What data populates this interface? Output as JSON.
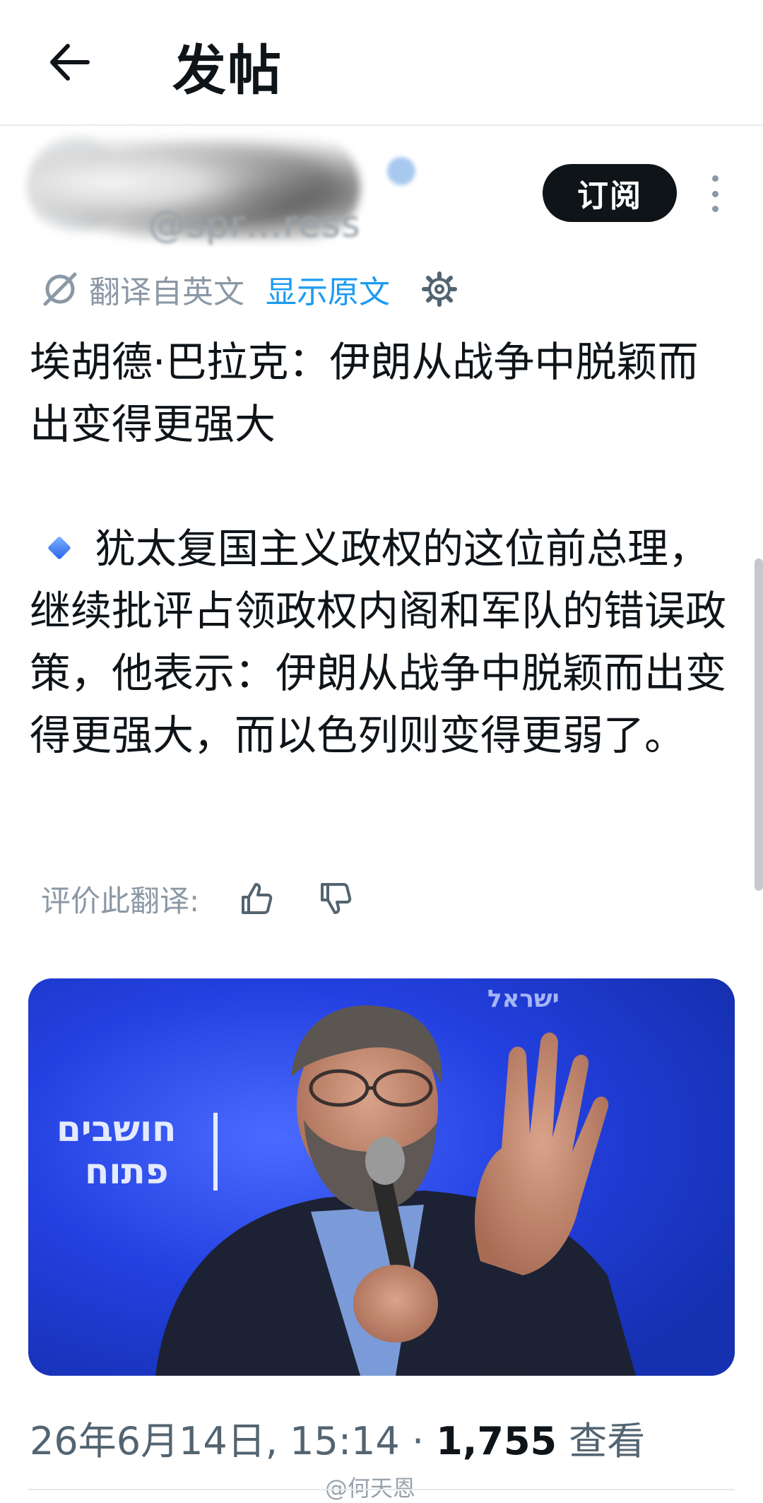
{
  "header": {
    "title": "发帖",
    "back_icon": "arrow-left-icon"
  },
  "author": {
    "handle": "@spr…ress",
    "subscribe_label": "订阅"
  },
  "translation": {
    "translated_from": "翻译自英文",
    "show_original": "显示原文",
    "rate_label": "评价此翻译:"
  },
  "post": {
    "title": "埃胡德·巴拉克：伊朗从战争中脱颖而出变得更强大",
    "body": "犹太复国主义政权的这位前总理，继续批评占领政权内阁和军队的错误政策，他表示：伊朗从战争中脱颖而出变得更强大，而以色列则变得更弱了。"
  },
  "media": {
    "sign_text_1": "חושבים",
    "sign_text_2": "פתוח",
    "sign_text_3": "ישראל"
  },
  "meta": {
    "date": "26年6月14日",
    "time": "15:14",
    "separator": "·",
    "views_count": "1,755",
    "views_label": "查看"
  },
  "watermark": "@何天恩",
  "colors": {
    "accent": "#1d9bf0",
    "text": "#0f1419",
    "muted": "#536471"
  }
}
